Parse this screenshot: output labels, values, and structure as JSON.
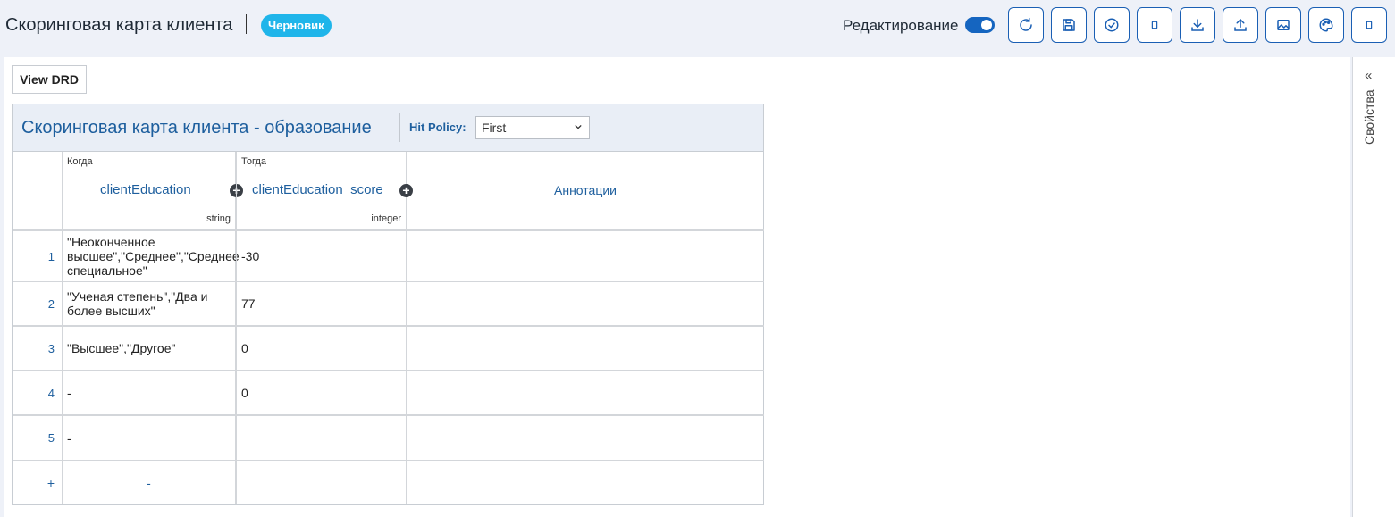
{
  "header": {
    "title": "Скоринговая карта клиента",
    "status_badge": "Черновик",
    "edit_label": "Редактирование",
    "edit_enabled": true,
    "toolbar_icons": [
      "refresh-icon",
      "save-icon",
      "check-icon",
      "blank-icon",
      "download-icon",
      "upload-icon",
      "image-icon",
      "palette-icon",
      "blank-icon"
    ]
  },
  "canvas": {
    "view_drd_label": "View DRD"
  },
  "side_panel": {
    "collapse_glyph": "«",
    "label": "Свойства"
  },
  "decision_table": {
    "name": "Скоринговая карта клиента - образование",
    "hit_policy_label": "Hit Policy:",
    "hit_policy_value": "First",
    "input_column": {
      "section": "Когда",
      "name": "clientEducation",
      "type": "string"
    },
    "output_column": {
      "section": "Тогда",
      "name": "clientEducation_score",
      "type": "integer"
    },
    "annotations_header": "Аннотации",
    "rows": [
      {
        "num": "1",
        "input": "\"Неоконченное высшее\",\"Среднее\",\"Среднее специальное\"",
        "output": "-30",
        "annotation": ""
      },
      {
        "num": "2",
        "input": "\"Ученая степень\",\"Два и более высших\"",
        "output": "77",
        "annotation": ""
      },
      {
        "num": "3",
        "input": "\"Высшее\",\"Другое\"",
        "output": "0",
        "annotation": ""
      },
      {
        "num": "4",
        "input": "-",
        "output": "0",
        "annotation": ""
      },
      {
        "num": "5",
        "input": "-",
        "output": "",
        "annotation": ""
      }
    ],
    "add_row": {
      "num": "+",
      "input": "-"
    }
  },
  "colors": {
    "accent": "#1a5fb4",
    "badge": "#1fb5ea",
    "table_header_bg": "#e9eef6",
    "link_text": "#1e5f9e"
  }
}
